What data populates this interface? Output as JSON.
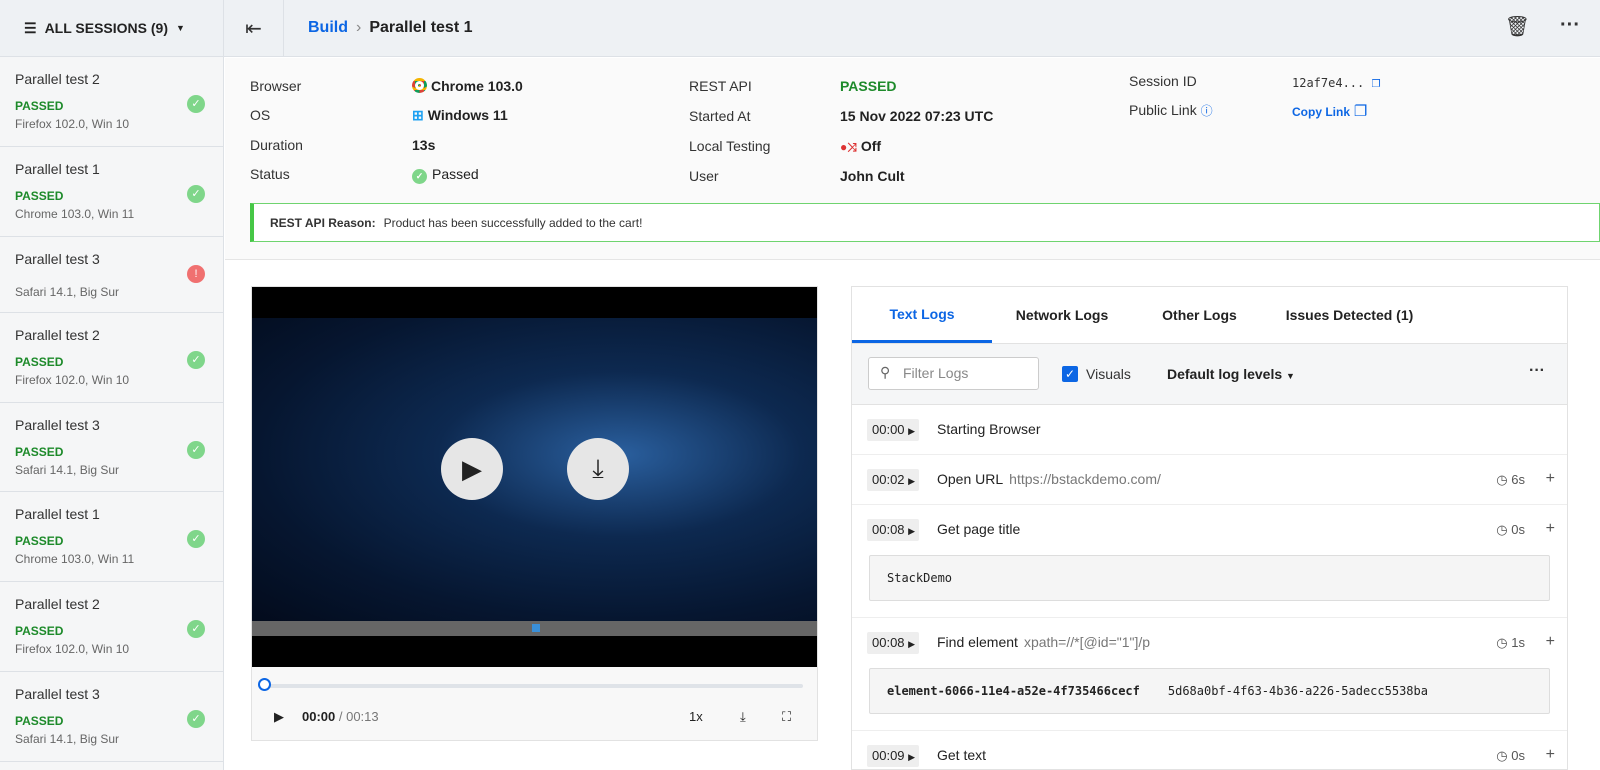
{
  "sidebar": {
    "title": "ALL SESSIONS (9)",
    "items": [
      {
        "name": "Parallel test 2",
        "status": "PASSED",
        "details": "Firefox 102.0, Win 10",
        "state": "passed"
      },
      {
        "name": "Parallel test 1",
        "status": "PASSED",
        "details": "Chrome 103.0, Win 11",
        "state": "passed"
      },
      {
        "name": "Parallel test 3",
        "status": "",
        "details": "Safari 14.1, Big Sur",
        "state": "error"
      },
      {
        "name": "Parallel test 2",
        "status": "PASSED",
        "details": "Firefox 102.0, Win 10",
        "state": "passed"
      },
      {
        "name": "Parallel test 3",
        "status": "PASSED",
        "details": "Safari 14.1, Big Sur",
        "state": "passed"
      },
      {
        "name": "Parallel test 1",
        "status": "PASSED",
        "details": "Chrome 103.0, Win 11",
        "state": "passed"
      },
      {
        "name": "Parallel test 2",
        "status": "PASSED",
        "details": "Firefox 102.0, Win 10",
        "state": "passed"
      },
      {
        "name": "Parallel test 3",
        "status": "PASSED",
        "details": "Safari 14.1, Big Sur",
        "state": "passed"
      }
    ]
  },
  "header": {
    "breadcrumb_root": "Build",
    "breadcrumb_current": "Parallel test 1"
  },
  "info": {
    "browser_label": "Browser",
    "browser": "Chrome 103.0",
    "os_label": "OS",
    "os": "Windows 11",
    "duration_label": "Duration",
    "duration": "13s",
    "status_label": "Status",
    "status": "Passed",
    "rest_label": "REST API",
    "rest": "PASSED",
    "started_label": "Started At",
    "started": "15 Nov 2022 07:23 UTC",
    "local_label": "Local Testing",
    "local": "Off",
    "user_label": "User",
    "user": "John Cult",
    "session_label": "Session ID",
    "session": "12af7e4...",
    "public_label": "Public Link",
    "copy_link": "Copy Link",
    "reason_label": "REST API Reason:",
    "reason": "Product has been successfully added to the cart!"
  },
  "video": {
    "current": "00:00",
    "total": "/ 00:13",
    "speed": "1x",
    "progress": 0
  },
  "logs": {
    "tabs": [
      "Text Logs",
      "Network Logs",
      "Other Logs",
      "Issues Detected (1)"
    ],
    "filter_placeholder": "Filter Logs",
    "visuals": "Visuals",
    "levels": "Default log levels",
    "rows": [
      {
        "time": "00:00",
        "action": "Starting Browser",
        "arg": "",
        "dur": ""
      },
      {
        "time": "00:02",
        "action": "Open URL",
        "arg": "https://bstackdemo.com/",
        "dur": "6s"
      },
      {
        "time": "00:08",
        "action": "Get page title",
        "arg": "",
        "dur": "0s",
        "output": "StackDemo"
      },
      {
        "time": "00:08",
        "action": "Find element",
        "arg": "xpath=//*[@id=\"1\"]/p",
        "dur": "1s",
        "output_a": "element-6066-11e4-a52e-4f735466cecf",
        "output_b": "5d68a0bf-4f63-4b36-a226-5adecc5538ba"
      },
      {
        "time": "00:09",
        "action": "Get text",
        "arg": "",
        "dur": "0s"
      }
    ]
  }
}
